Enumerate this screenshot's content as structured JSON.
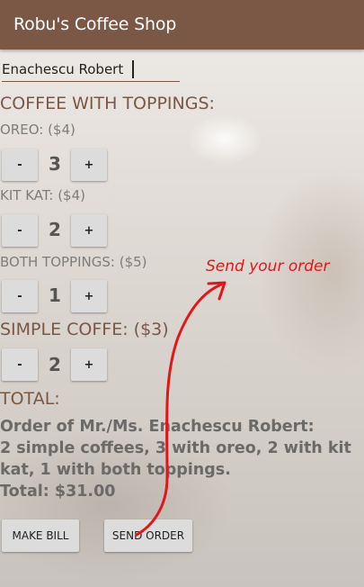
{
  "app_bar": {
    "title": "Robu's Coffee Shop"
  },
  "name_input": {
    "value": "Enachescu Robert"
  },
  "headings": {
    "coffee_with_toppings": "COFFEE WITH TOPPINGS:"
  },
  "items": [
    {
      "label": "OREO: ($4)",
      "quantity": "3",
      "minus": "-",
      "plus": "+"
    },
    {
      "label": "KIT KAT: ($4)",
      "quantity": "2",
      "minus": "-",
      "plus": "+"
    },
    {
      "label": "BOTH TOPPINGS: ($5)",
      "quantity": "1",
      "minus": "-",
      "plus": "+"
    },
    {
      "label": "SIMPLE COFFE: ($3)",
      "quantity": "2",
      "minus": "-",
      "plus": "+"
    }
  ],
  "total": {
    "heading": "TOTAL:",
    "lines": [
      "Order of Mr./Ms. Enachescu Robert:",
      "2 simple coffees, 3 with oreo, 2 with kit",
      "kat, 1 with both toppings.",
      "Total: $31.00"
    ]
  },
  "actions": {
    "make_bill": "MAKE BILL",
    "send_order": "SEND ORDER"
  },
  "annotation": {
    "text": "Send your order",
    "color": "#e0161b"
  },
  "colors": {
    "app_bar": "#7b5746",
    "accent": "#7b5746"
  }
}
